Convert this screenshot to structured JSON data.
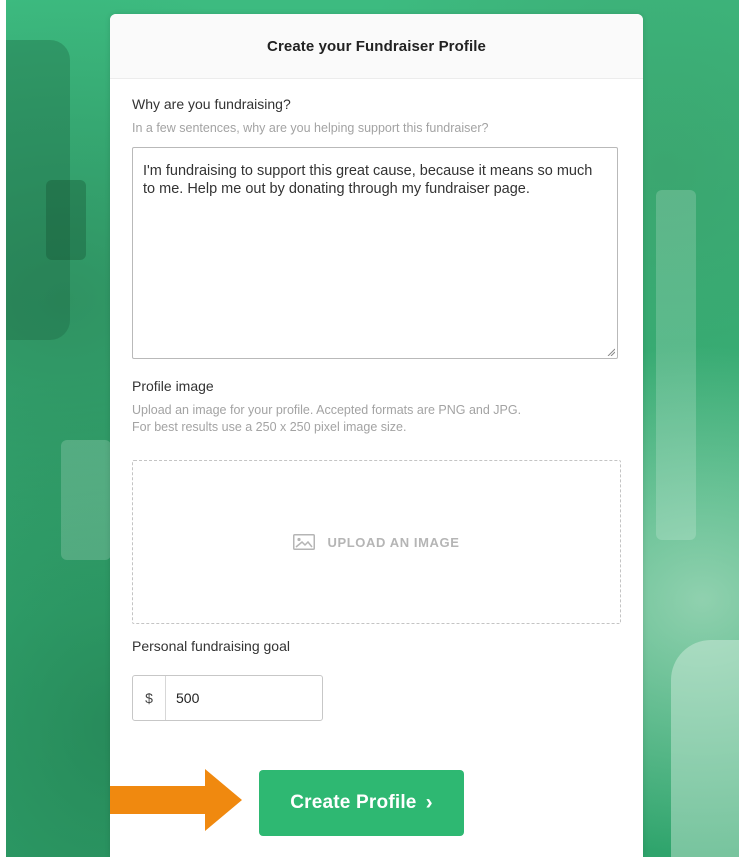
{
  "colors": {
    "background_green": "#36b076",
    "button_green": "#2eb872",
    "arrow_orange": "#f0890f",
    "card": "#ffffff"
  },
  "header": {
    "title": "Create your Fundraiser Profile"
  },
  "why_section": {
    "label": "Why are you fundraising?",
    "help": "In a few sentences, why are you helping support this fundraiser?",
    "textarea_value": "I'm fundraising to support this great cause, because it means so much to me. Help me out by donating through my fundraiser page."
  },
  "profile_image": {
    "label": "Profile image",
    "help_line1": "Upload an image for your profile. Accepted formats are PNG and JPG.",
    "help_line2": "For best results use a 250 x 250 pixel image size.",
    "upload_label": "UPLOAD AN IMAGE",
    "upload_icon": "image-icon"
  },
  "goal": {
    "label": "Personal fundraising goal",
    "currency_prefix": "$",
    "value": "500"
  },
  "submit": {
    "label": "Create Profile",
    "chevron": "›",
    "pointer_icon": "arrow-right-icon"
  }
}
